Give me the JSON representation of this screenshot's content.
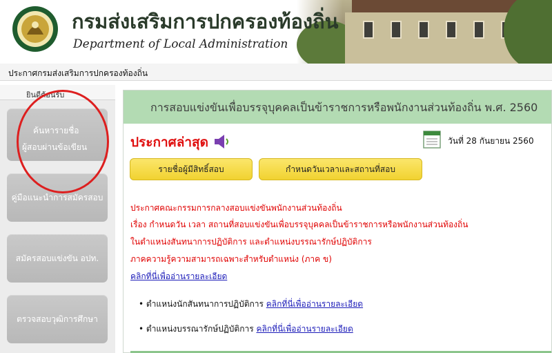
{
  "header": {
    "title_th": "กรมส่งเสริมการปกครองท้องถิ่น",
    "title_en": "Department of Local Administration",
    "logo_icon": "department-seal-logo"
  },
  "topbar": {
    "text": "ประกาศกรมส่งเสริมการปกครองท้องถิ่น"
  },
  "sidebar": {
    "heading": "ยินดีต้อนรับ",
    "buttons": [
      {
        "line1": "ค้นหารายชื่อ",
        "line2": "ผู้สอบผ่านข้อเขียน"
      },
      {
        "label": "คู่มือแนะนำการสมัครสอบ"
      },
      {
        "label": "สมัครสอบแข่งขัน อปท."
      },
      {
        "label": "ตรวจสอบวุฒิการศึกษา"
      }
    ]
  },
  "main": {
    "heading": "การสอบแข่งขันเพื่อบรรจุบุคคลเป็นข้าราชการหรือพนักงานส่วนท้องถิ่น พ.ศ. 2560",
    "latest_label": "ประกาศล่าสุด",
    "date": "วันที่ 28 กันยายน 2560",
    "yellow_buttons": [
      "รายชื่อผู้มีสิทธิ์สอบ",
      "กำหนดวันเวลาและสถานที่สอบ"
    ],
    "announcement": [
      "ประกาศคณะกรรมการกลางสอบแข่งขันพนักงานส่วนท้องถิ่น",
      "เรื่อง กำหนดวัน เวลา สถานที่สอบแข่งขันเพื่อบรรจุบุคคลเป็นข้าราชการหรือพนักงานส่วนท้องถิ่น",
      "ในตำแหน่งสันทนาการปฏิบัติการ และตำแหน่งบรรณารักษ์ปฏิบัติการ",
      "ภาคความรู้ความสามารถเฉพาะสำหรับตำแหน่ง (ภาค ข)"
    ],
    "main_link": "คลิกที่นี่เพื่ออ่านรายละเอียด",
    "bullets": [
      {
        "text": "• ตำแหน่งนักสันทนาการปฏิบัติการ ",
        "link": "คลิกที่นี่เพื่ออ่านรายละเอียด"
      },
      {
        "text": "• ตำแหน่งบรรณารักษ์ปฏิบัติการ ",
        "link": "คลิกที่นี่เพื่ออ่านรายละเอียด"
      }
    ]
  },
  "colors": {
    "accent_green": "#b3dbb3",
    "announcement_red": "#e00000",
    "link_blue": "#1a1ab8",
    "button_yellow": "#f1d230",
    "highlight_circle": "#dd1f1f"
  }
}
